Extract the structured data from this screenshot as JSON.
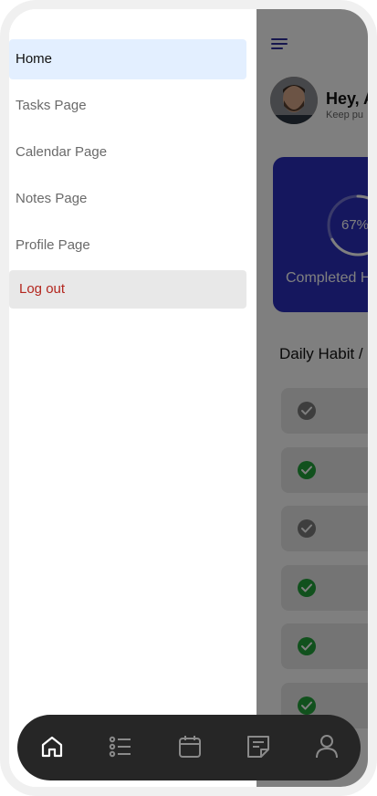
{
  "drawer": {
    "items": [
      {
        "label": "Home",
        "active": true
      },
      {
        "label": "Tasks Page",
        "active": false
      },
      {
        "label": "Calendar Page",
        "active": false
      },
      {
        "label": "Notes Page",
        "active": false
      },
      {
        "label": "Profile Page",
        "active": false
      }
    ],
    "logout_label": "Log out"
  },
  "header": {
    "menu_icon": "menu-icon",
    "greeting": "Hey, A",
    "subtitle": "Keep pu"
  },
  "progress_card": {
    "percent_label": "67%",
    "percent_value": 67,
    "label": "Completed H"
  },
  "habits": {
    "title": "Daily Habit /",
    "items": [
      {
        "completed": false
      },
      {
        "completed": true
      },
      {
        "completed": false
      },
      {
        "completed": true
      },
      {
        "completed": true
      },
      {
        "completed": true
      }
    ]
  },
  "bottom_nav": {
    "items": [
      {
        "icon": "home-icon",
        "active": true
      },
      {
        "icon": "list-icon",
        "active": false
      },
      {
        "icon": "calendar-icon",
        "active": false
      },
      {
        "icon": "notes-icon",
        "active": false
      },
      {
        "icon": "profile-icon",
        "active": false
      }
    ]
  },
  "colors": {
    "accent": "#2b2fbd",
    "done": "#22a33a",
    "todo": "#7d7d7d",
    "logout": "#b3261e",
    "active_item_bg": "#e3efff",
    "nav_bg": "#262626"
  }
}
